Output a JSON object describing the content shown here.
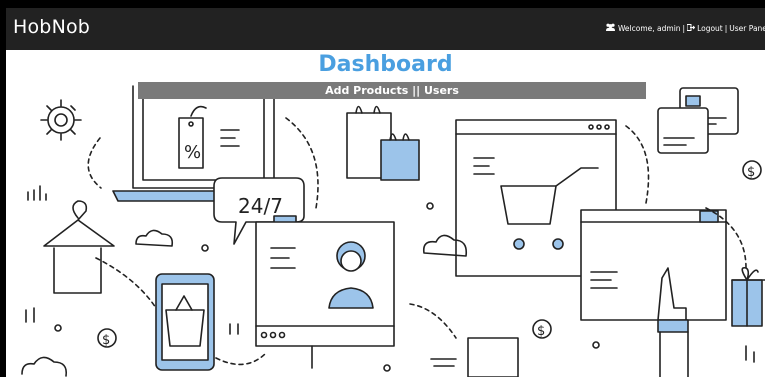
{
  "navbar": {
    "brand": "HobNob",
    "welcome_text": "Welcome, admin",
    "separator1": "|",
    "logout_label": "Logout",
    "separator2": "|",
    "user_panel_label": "User Panel"
  },
  "main": {
    "title": "Dashboard",
    "add_products_label": "Add Products",
    "links_separator": "||",
    "users_label": "Users"
  },
  "hero": {
    "clock_text": "24/7",
    "percent_text": "%",
    "dollar_text": "$"
  },
  "colors": {
    "navbar_bg": "#222222",
    "title_color": "#4a9fe0",
    "linkbar_bg": "#7a7a7a",
    "accent_blue": "#9cc4ea"
  }
}
